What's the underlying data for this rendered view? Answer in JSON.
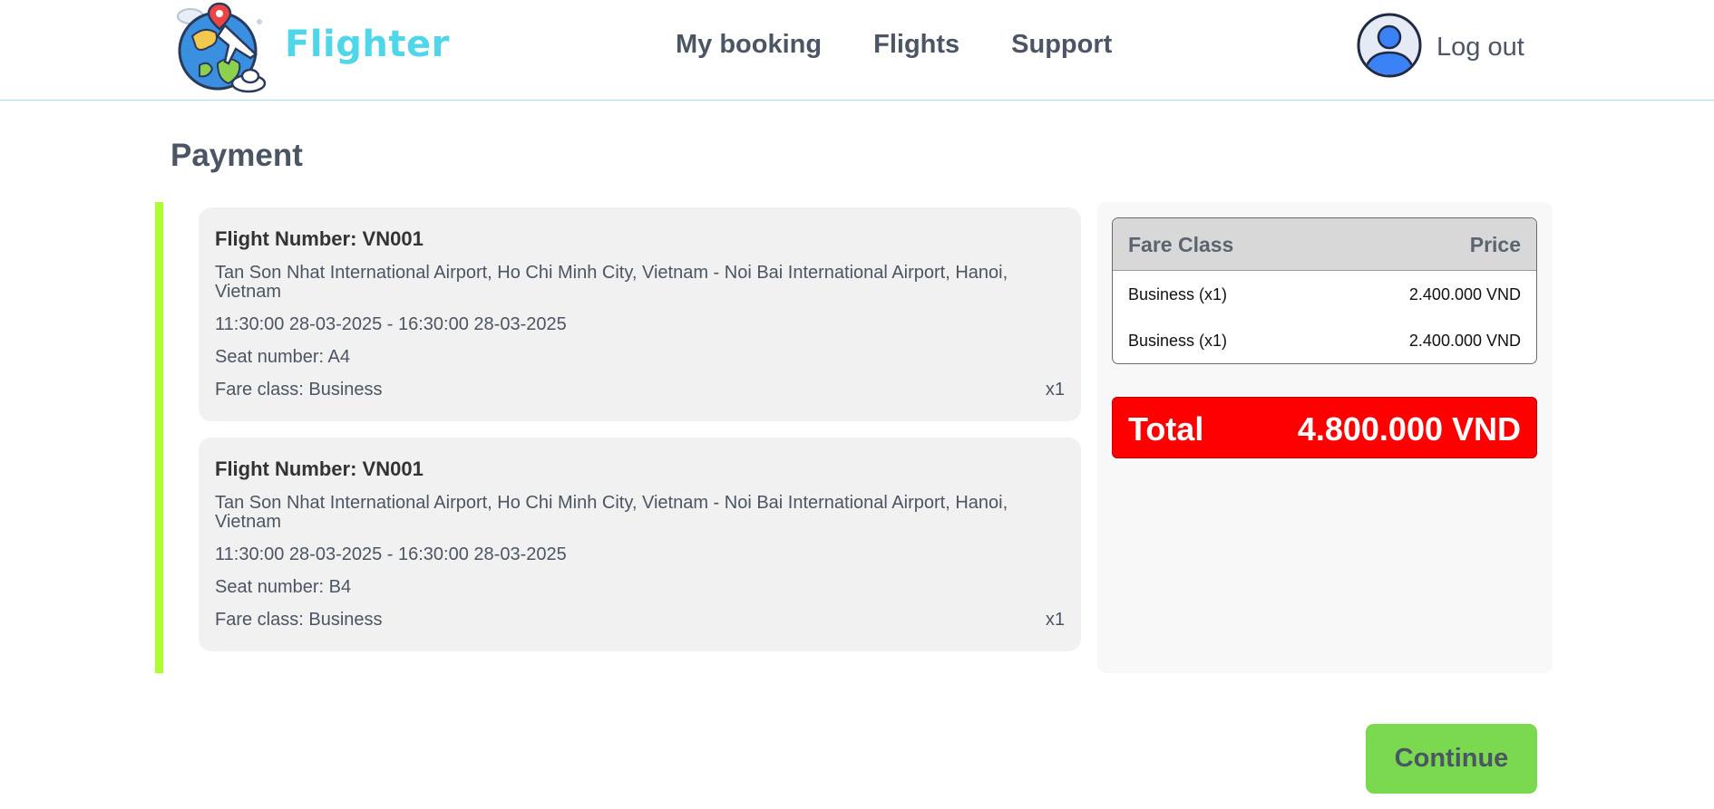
{
  "header": {
    "brand": "Flighter",
    "nav": [
      "My booking",
      "Flights",
      "Support"
    ],
    "logout_label": "Log out",
    "logo_icon": "globe-airplane-logo-icon",
    "avatar_icon": "user-avatar-icon"
  },
  "page": {
    "title": "Payment"
  },
  "tickets": [
    {
      "flight_number": "Flight Number: VN001",
      "route": "Tan Son Nhat International Airport, Ho Chi Minh City, Vietnam - Noi Bai International Airport, Hanoi, Vietnam",
      "time": "11:30:00 28-03-2025 - 16:30:00 28-03-2025",
      "seat": "Seat number: A4",
      "fare_class": "Fare class: Business",
      "quantity": "x1"
    },
    {
      "flight_number": "Flight Number: VN001",
      "route": "Tan Son Nhat International Airport, Ho Chi Minh City, Vietnam - Noi Bai International Airport, Hanoi, Vietnam",
      "time": "11:30:00 28-03-2025 - 16:30:00 28-03-2025",
      "seat": "Seat number: B4",
      "fare_class": "Fare class: Business",
      "quantity": "x1"
    }
  ],
  "summary": {
    "headers": {
      "fare_class": "Fare Class",
      "price": "Price"
    },
    "rows": [
      {
        "fare": "Business (x1)",
        "price": "2.400.000 VND"
      },
      {
        "fare": "Business (x1)",
        "price": "2.400.000 VND"
      }
    ],
    "total_label": "Total",
    "total_value": "4.800.000 VND"
  },
  "actions": {
    "continue_label": "Continue"
  },
  "colors": {
    "accent_bar": "#adff2f",
    "total_bg": "#ff0000",
    "continue_bg": "#7ad94f",
    "brand": "#4fd6e8"
  }
}
